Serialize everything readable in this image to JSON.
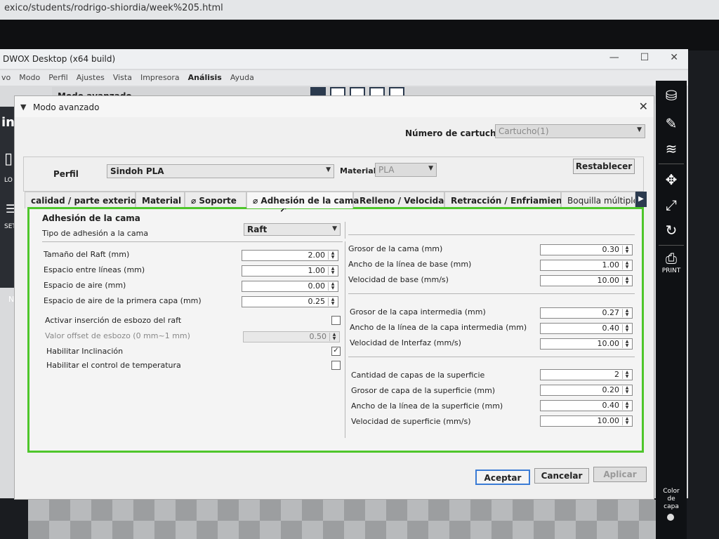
{
  "browser": {
    "url_fragment": "exico/students/rodrigo-shiordia/week%205.html"
  },
  "app": {
    "title": "DWOX Desktop (x64 build)",
    "menu": [
      "vo",
      "Modo",
      "Perfil",
      "Ajustes",
      "Vista",
      "Impresora",
      "Análisis",
      "Ayuda"
    ],
    "mode_label": "Modo avanzado",
    "left_panel": {
      "big_text": "in",
      "load_label": "LO",
      "settings_label": "SET",
      "no_label": "No"
    },
    "right_toolbar": {
      "print_label": "PRINT",
      "color_label_1": "Color",
      "color_label_2": "de",
      "color_label_3": "capa"
    },
    "win_controls": {
      "minimize": "—",
      "maximize": "☐",
      "close": "✕"
    }
  },
  "dialog": {
    "title": "Modo avanzado",
    "cartridge": {
      "label": "Número de cartucho",
      "value": "Cartucho(1)"
    },
    "profile": {
      "label": "Perfil",
      "value": "Sindoh PLA"
    },
    "material": {
      "label": "Material",
      "value": "PLA"
    },
    "reset_label": "Restablecer",
    "tabs": [
      "calidad / parte exterior",
      "Material",
      "Soporte",
      "Adhesión de la cama",
      "Relleno / Velocidad",
      "Retracción / Enfriamiento",
      "Boquilla múltiple"
    ],
    "active_tab": "Adhesión de la cama",
    "section_title": "Adhesión de la cama",
    "adhesion_type": {
      "label": "Tipo de adhesión a la cama",
      "value": "Raft"
    },
    "left_fields": [
      {
        "label": "Tamaño del Raft (mm)",
        "value": "2.00"
      },
      {
        "label": "Espacio entre líneas (mm)",
        "value": "1.00"
      },
      {
        "label": "Espacio de aire (mm)",
        "value": "0.00"
      },
      {
        "label": "Espacio de aire de la primera capa (mm)",
        "value": "0.25"
      }
    ],
    "sketch_insert": {
      "label": "Activar inserción de esbozo del raft",
      "checked": false
    },
    "sketch_offset": {
      "label": "Valor offset de esbozo (0 mm~1 mm)",
      "value": "0.50"
    },
    "tilt": {
      "label": "Habilitar Inclinación",
      "checked": true
    },
    "temp_control": {
      "label": "Habilitar el control de temperatura",
      "checked": false
    },
    "right_group1": [
      {
        "label": "Grosor de la cama (mm)",
        "value": "0.30"
      },
      {
        "label": "Ancho de la línea de base (mm)",
        "value": "1.00"
      },
      {
        "label": "Velocidad de base (mm/s)",
        "value": "10.00"
      }
    ],
    "right_group2": [
      {
        "label": "Grosor de la capa intermedia (mm)",
        "value": "0.27"
      },
      {
        "label": "Ancho de la línea de la capa intermedia (mm)",
        "value": "0.40"
      },
      {
        "label": "Velocidad de Interfaz (mm/s)",
        "value": "10.00"
      }
    ],
    "right_group3": [
      {
        "label": "Cantidad de capas de la superficie",
        "value": "2"
      },
      {
        "label": "Grosor de capa de la superficie (mm)",
        "value": "0.20"
      },
      {
        "label": "Ancho de la línea de la superficie (mm)",
        "value": "0.40"
      },
      {
        "label": "Velocidad de superficie (mm/s)",
        "value": "10.00"
      }
    ],
    "buttons": {
      "accept": "Aceptar",
      "cancel": "Cancelar",
      "apply": "Aplicar"
    }
  },
  "colors": {
    "accent_green": "#4ec62b",
    "focus_blue": "#3a7bd5",
    "toolbar_dark": "#0f1114"
  }
}
